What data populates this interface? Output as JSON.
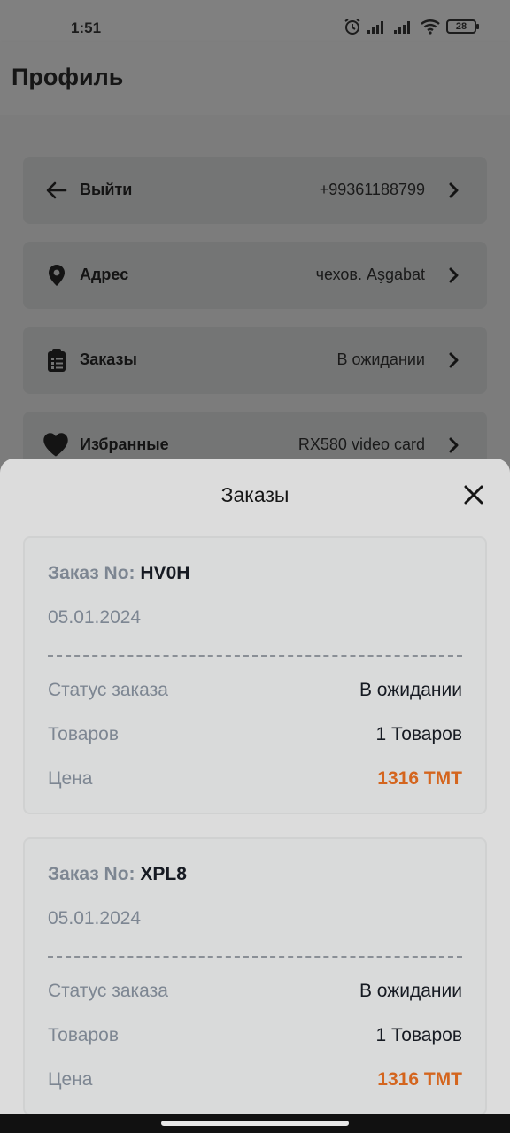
{
  "status_bar": {
    "time": "1:51",
    "battery": "28",
    "icons": [
      "alarm-icon",
      "signal-icon",
      "signal-icon",
      "wifi-icon",
      "battery-icon"
    ]
  },
  "header": {
    "title": "Профиль"
  },
  "menu": [
    {
      "label": "Выйти",
      "value": "+99361188799",
      "icon": "arrow-left-icon"
    },
    {
      "label": "Адрес",
      "value": "чехов. Aşgabat",
      "icon": "location-pin-icon"
    },
    {
      "label": "Заказы",
      "value": "В ожидании",
      "icon": "clipboard-icon"
    },
    {
      "label": "Избранные",
      "value": "RX580 video card",
      "icon": "heart-icon"
    }
  ],
  "sheet": {
    "title": "Заказы",
    "orders": [
      {
        "no_label": "Заказ No:",
        "no_value": "HV0H",
        "date": "05.01.2024",
        "status_label": "Статус заказа",
        "status_value": "В ожидании",
        "items_label": "Товаров",
        "items_value": "1 Товаров",
        "price_label": "Цена",
        "price_value": "1316 TMT"
      },
      {
        "no_label": "Заказ No:",
        "no_value": "XPL8",
        "date": "05.01.2024",
        "status_label": "Статус заказа",
        "status_value": "В ожидании",
        "items_label": "Товаров",
        "items_value": "1 Товаров",
        "price_label": "Цена",
        "price_value": "1316 TMT"
      }
    ]
  },
  "colors": {
    "accent_price": "#d4651e",
    "muted_text": "#7d8692",
    "sheet_bg": "#dcdcdc",
    "overlay": "#7f7f7f"
  }
}
